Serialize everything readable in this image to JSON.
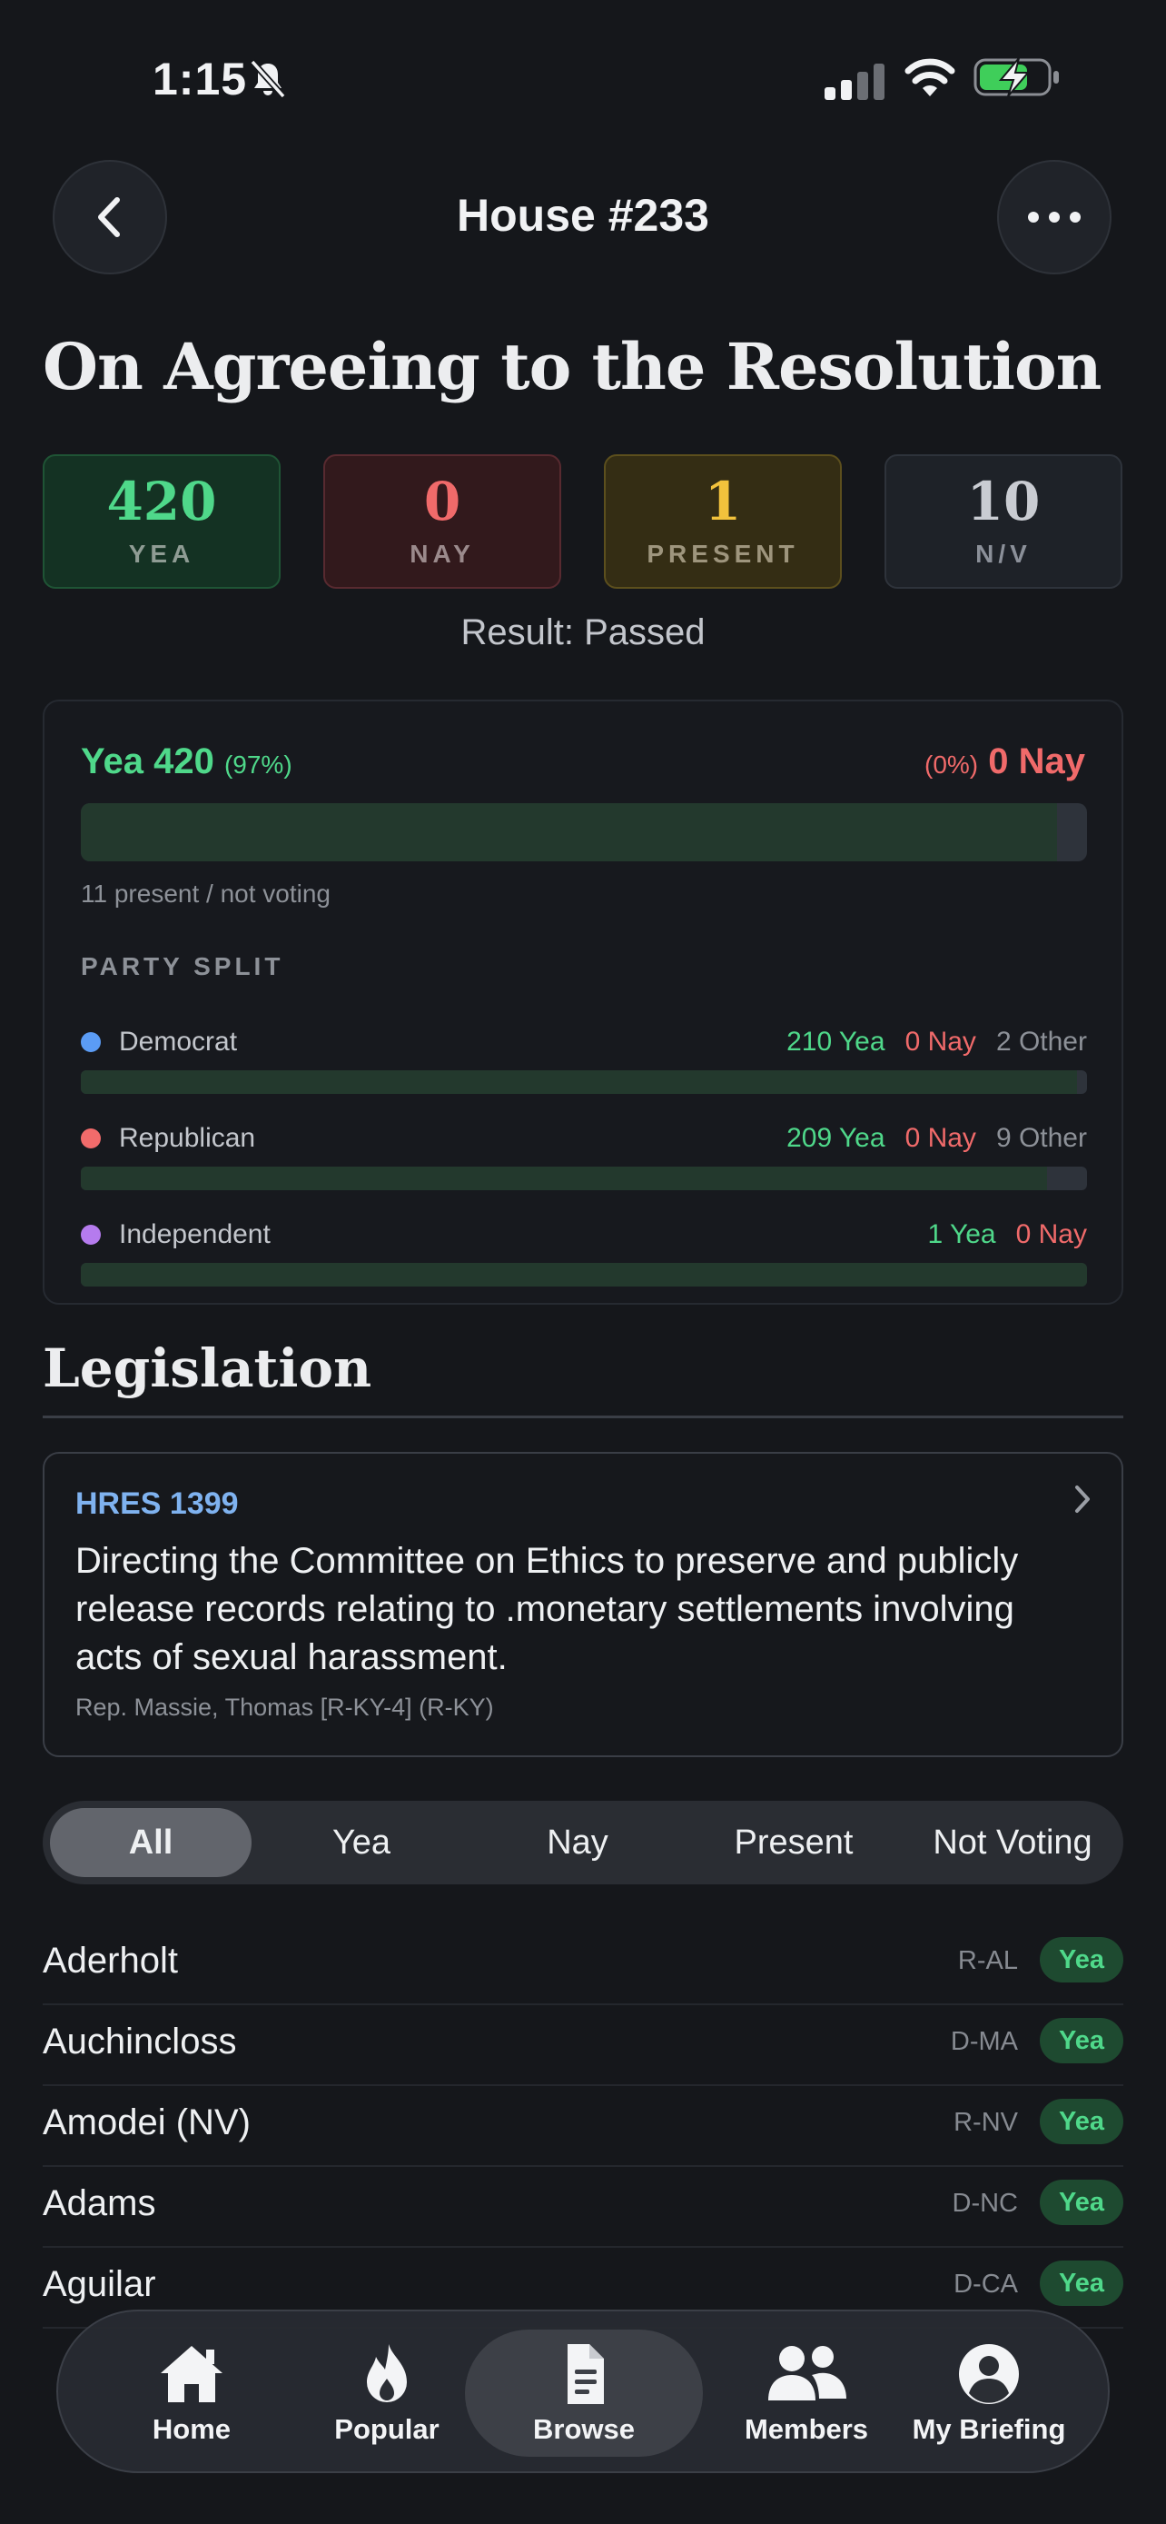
{
  "status_bar": {
    "time": "1:15"
  },
  "header": {
    "title": "House #233"
  },
  "vote": {
    "question": "On Agreeing to the Resolution",
    "tallies": [
      {
        "key": "yea",
        "value": "420",
        "label": "YEA"
      },
      {
        "key": "nay",
        "value": "0",
        "label": "NAY"
      },
      {
        "key": "present",
        "value": "1",
        "label": "PRESENT"
      },
      {
        "key": "nv",
        "value": "10",
        "label": "N/V"
      }
    ],
    "result": "Result: Passed"
  },
  "breakdown": {
    "yea_label": "Yea 420",
    "yea_pct": "(97%)",
    "nay_pct": "(0%)",
    "nay_label": "0 Nay",
    "yea_fraction": 0.97,
    "present_note": "11 present / not voting",
    "party_split_title": "PARTY SPLIT",
    "parties": [
      {
        "name": "Democrat",
        "color": "#5b9cf5",
        "yea": "210 Yea",
        "nay": "0 Nay",
        "other": "2 Other",
        "yea_fraction": 0.99
      },
      {
        "name": "Republican",
        "color": "#f26b6b",
        "yea": "209 Yea",
        "nay": "0 Nay",
        "other": "9 Other",
        "yea_fraction": 0.96
      },
      {
        "name": "Independent",
        "color": "#b57bee",
        "yea": "1 Yea",
        "nay": "0 Nay",
        "other": "",
        "yea_fraction": 1.0
      }
    ]
  },
  "legislation": {
    "title": "Legislation",
    "bill_id": "HRES 1399",
    "description": "Directing the Committee on Ethics to preserve and publicly release records relating to .monetary settlements involving acts of sexual harassment.",
    "sponsor": "Rep. Massie, Thomas [R-KY-4] (R-KY)"
  },
  "filters": [
    "All",
    "Yea",
    "Nay",
    "Present",
    "Not Voting"
  ],
  "members": [
    {
      "name": "Aderholt",
      "party": "R-AL",
      "vote": "Yea"
    },
    {
      "name": "Auchincloss",
      "party": "D-MA",
      "vote": "Yea"
    },
    {
      "name": "Amodei (NV)",
      "party": "R-NV",
      "vote": "Yea"
    },
    {
      "name": "Adams",
      "party": "D-NC",
      "vote": "Yea"
    },
    {
      "name": "Aguilar",
      "party": "D-CA",
      "vote": "Yea"
    }
  ],
  "tabs": [
    {
      "label": "Home",
      "icon": "home-icon"
    },
    {
      "label": "Popular",
      "icon": "flame-icon"
    },
    {
      "label": "Browse",
      "icon": "document-icon"
    },
    {
      "label": "Members",
      "icon": "people-icon"
    },
    {
      "label": "My Briefing",
      "icon": "person-icon"
    }
  ],
  "colors": {
    "yea": "#4fd88a",
    "nay": "#f06a6a",
    "present": "#f2c23c",
    "link": "#7fb2ef"
  }
}
